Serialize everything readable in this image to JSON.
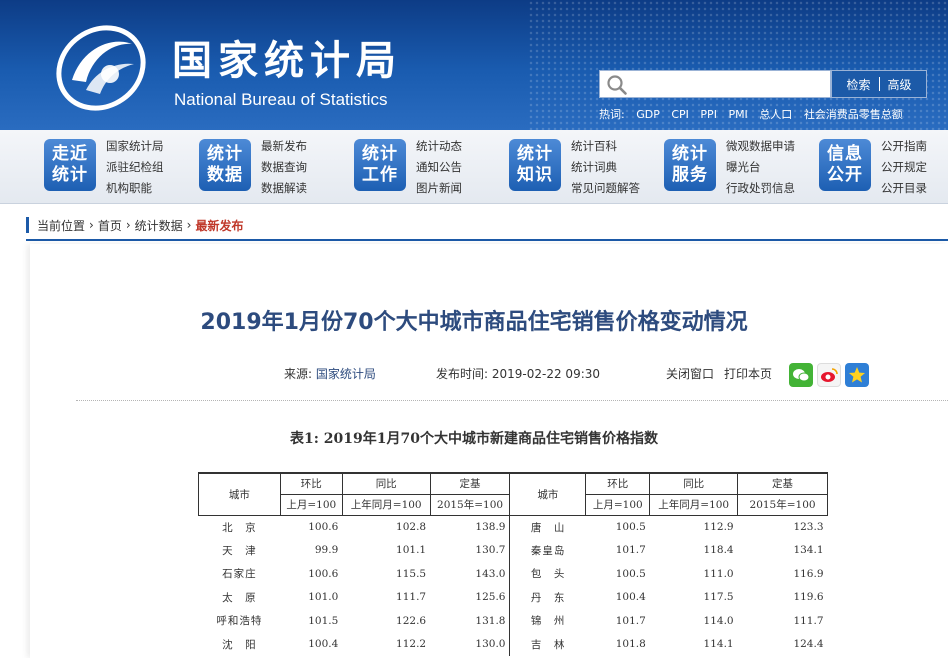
{
  "header": {
    "title": "国家统计局",
    "subtitle": "National Bureau of Statistics",
    "search": {
      "placeholder": "",
      "button_search": "检索",
      "button_advanced": "高级",
      "hotwords_label": "热词:",
      "hotwords": [
        "GDP",
        "CPI",
        "PPI",
        "PMI",
        "总人口",
        "社会消费品零售总额"
      ]
    },
    "colors": {
      "primary": "#1c5aa8",
      "dark": "#0d3c86"
    }
  },
  "nav": [
    {
      "badge": [
        "走近",
        "统计"
      ],
      "links": [
        "国家统计局",
        "派驻纪检组",
        "机构职能"
      ]
    },
    {
      "badge": [
        "统计",
        "数据"
      ],
      "links": [
        "最新发布",
        "数据查询",
        "数据解读"
      ]
    },
    {
      "badge": [
        "统计",
        "工作"
      ],
      "links": [
        "统计动态",
        "通知公告",
        "图片新闻"
      ]
    },
    {
      "badge": [
        "统计",
        "知识"
      ],
      "links": [
        "统计百科",
        "统计词典",
        "常见问题解答"
      ]
    },
    {
      "badge": [
        "统计",
        "服务"
      ],
      "links": [
        "微观数据申请",
        "曝光台",
        "行政处罚信息"
      ]
    },
    {
      "badge": [
        "信息",
        "公开"
      ],
      "links": [
        "公开指南",
        "公开规定",
        "公开目录"
      ]
    }
  ],
  "breadcrumb": {
    "label": "当前位置",
    "items": [
      "首页",
      "统计数据"
    ],
    "current": "最新发布"
  },
  "article": {
    "title": "2019年1月份70个大中城市商品住宅销售价格变动情况",
    "source_label": "来源:",
    "source": "国家统计局",
    "time_label": "发布时间:",
    "time": "2019-02-22 09:30",
    "close_window": "关闭窗口",
    "print_page": "打印本页",
    "share_icons": [
      "wechat-icon",
      "weibo-icon",
      "favorite-icon"
    ]
  },
  "table": {
    "title": "表1: 2019年1月70个大中城市新建商品住宅销售价格指数",
    "header_city": "城市",
    "header_groups": [
      "环比",
      "同比",
      "定基"
    ],
    "header_bases": [
      "上月=100",
      "上年同月=100",
      "2015年=100"
    ],
    "rows": [
      {
        "left": [
          "北　京",
          "100.6",
          "102.8",
          "138.9"
        ],
        "right": [
          "唐　山",
          "100.5",
          "112.9",
          "123.3"
        ]
      },
      {
        "left": [
          "天　津",
          "99.9",
          "101.1",
          "130.7"
        ],
        "right": [
          "秦皇岛",
          "101.7",
          "118.4",
          "134.1"
        ]
      },
      {
        "left": [
          "石家庄",
          "100.6",
          "115.5",
          "143.0"
        ],
        "right": [
          "包　头",
          "100.5",
          "111.0",
          "116.9"
        ]
      },
      {
        "left": [
          "太　原",
          "101.0",
          "111.7",
          "125.6"
        ],
        "right": [
          "丹　东",
          "100.4",
          "117.5",
          "119.6"
        ]
      },
      {
        "left": [
          "呼和浩特",
          "101.5",
          "122.6",
          "131.8"
        ],
        "right": [
          "锦　州",
          "101.7",
          "114.0",
          "111.7"
        ]
      },
      {
        "left": [
          "沈　阳",
          "100.4",
          "112.2",
          "130.0"
        ],
        "right": [
          "吉　林",
          "101.8",
          "114.1",
          "124.4"
        ]
      }
    ]
  }
}
